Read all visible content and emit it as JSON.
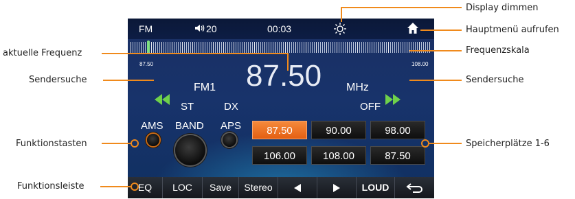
{
  "status_bar": {
    "band": "FM",
    "volume": "20",
    "time": "00:03"
  },
  "scale": {
    "min_label": "87.50",
    "max_label": "108.00",
    "needle_fraction": 0.0
  },
  "display": {
    "band_channel": "FM1",
    "frequency": "87.50",
    "unit": "MHz",
    "st": "ST",
    "dx": "DX",
    "off": "OFF"
  },
  "functions": {
    "ams": "AMS",
    "band": "BAND",
    "aps": "APS"
  },
  "presets": [
    {
      "label": "87.50",
      "active": true
    },
    {
      "label": "90.00",
      "active": false
    },
    {
      "label": "98.00",
      "active": false
    },
    {
      "label": "106.00",
      "active": false
    },
    {
      "label": "108.00",
      "active": false
    },
    {
      "label": "87.50",
      "active": false
    }
  ],
  "function_bar": {
    "eq": "EQ",
    "loc": "LOC",
    "save": "Save",
    "stereo": "Stereo",
    "loud": "LOUD"
  },
  "annotations": {
    "display_dim": "Display dimmen",
    "main_menu": "Hauptmenü aufrufen",
    "freq_scale": "Frequenzskala",
    "current_freq": "aktuelle Frequenz",
    "seek_left": "Sendersuche",
    "seek_right": "Sendersuche",
    "function_keys": "Funktionstasten",
    "memory": "Speicherplätze 1-6",
    "function_bar": "Funktionsleiste"
  },
  "icons": [
    "speaker-icon",
    "brightness-icon",
    "home-icon",
    "seek-back-icon",
    "seek-forward-icon",
    "prev-icon",
    "next-icon",
    "return-icon"
  ],
  "colors": {
    "accent": "#f08a1c",
    "preset_active": "#f07a2a",
    "screen_bg": "#18336b",
    "seek_green": "#6fd14a"
  }
}
